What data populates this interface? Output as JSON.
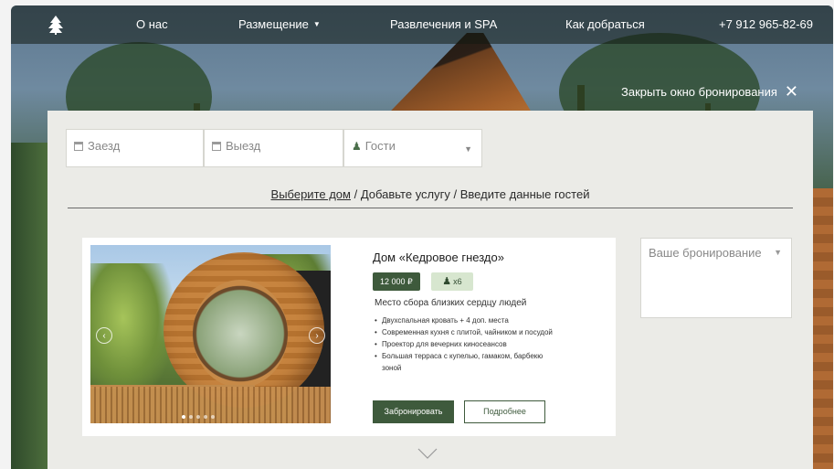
{
  "nav": {
    "logo_icon": "fir-tree-logo-icon",
    "items": [
      {
        "label": "О нас"
      },
      {
        "label": "Размещение",
        "has_dropdown": true
      },
      {
        "label": "Развлечения и SPA"
      },
      {
        "label": "Как добраться"
      },
      {
        "label": "+7 912 965-82-69"
      }
    ]
  },
  "close_booking": {
    "label": "Закрыть окно бронирования"
  },
  "search": {
    "checkin": {
      "placeholder": "Заезд",
      "icon": "calendar-icon"
    },
    "checkout": {
      "placeholder": "Выезд",
      "icon": "calendar-icon"
    },
    "guests": {
      "placeholder": "Гости",
      "icon": "person-icon"
    }
  },
  "steps": {
    "step1": "Выберите дом",
    "separator": " / ",
    "step2": "Добавьте услугу",
    "step3": "Введите данные гостей"
  },
  "house": {
    "title": "Дом «Кедровое гнездо»",
    "price": "12 000 ₽",
    "guests": "x6",
    "subtitle": "Место сбора близких сердцу людей",
    "features": [
      "Двухспальная кровать + 4 доп. места",
      "Современная кухня с плитой, чайником и посудой",
      "Проектор для вечерних киносеансов",
      "Большая терраса с купелью, гамаком, барбекю зоной"
    ],
    "book_label": "Забронировать",
    "more_label": "Подробнее",
    "gallery_current": 1,
    "gallery_count": 5
  },
  "summary": {
    "label": "Ваше бронирование"
  },
  "colors": {
    "brand_green": "#3e5a3c",
    "badge_light_green": "#d7e6cf",
    "panel_bg": "#ebebe7"
  }
}
